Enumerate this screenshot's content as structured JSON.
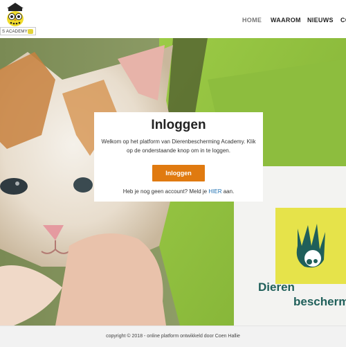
{
  "header": {
    "logo_text": "S ACADEMY",
    "nav": [
      {
        "label": "HOME",
        "active": true
      },
      {
        "label": "WAAROM",
        "active": false
      },
      {
        "label": "NIEUWS",
        "active": false
      },
      {
        "label": "CO",
        "active": false
      }
    ]
  },
  "hero": {
    "sign_text_line1": "Dieren",
    "sign_text_line2": "bescherm",
    "colors": {
      "vest_green": "#8fbc3a",
      "sign_yellow": "#e6e34a"
    }
  },
  "login": {
    "title": "Inloggen",
    "intro": "Welkom op het platform van Dierenbescherming Academy. Klik op de onderstaande knop om in te loggen.",
    "button_label": "Inloggen",
    "signup_prefix": "Heb je nog geen account? Meld je",
    "signup_link": "HIER",
    "signup_suffix": "aan.",
    "accent_color": "#e07a10"
  },
  "footer": {
    "text": "copyright © 2018 - online platform ontwikkeld door Coen Hallie"
  }
}
